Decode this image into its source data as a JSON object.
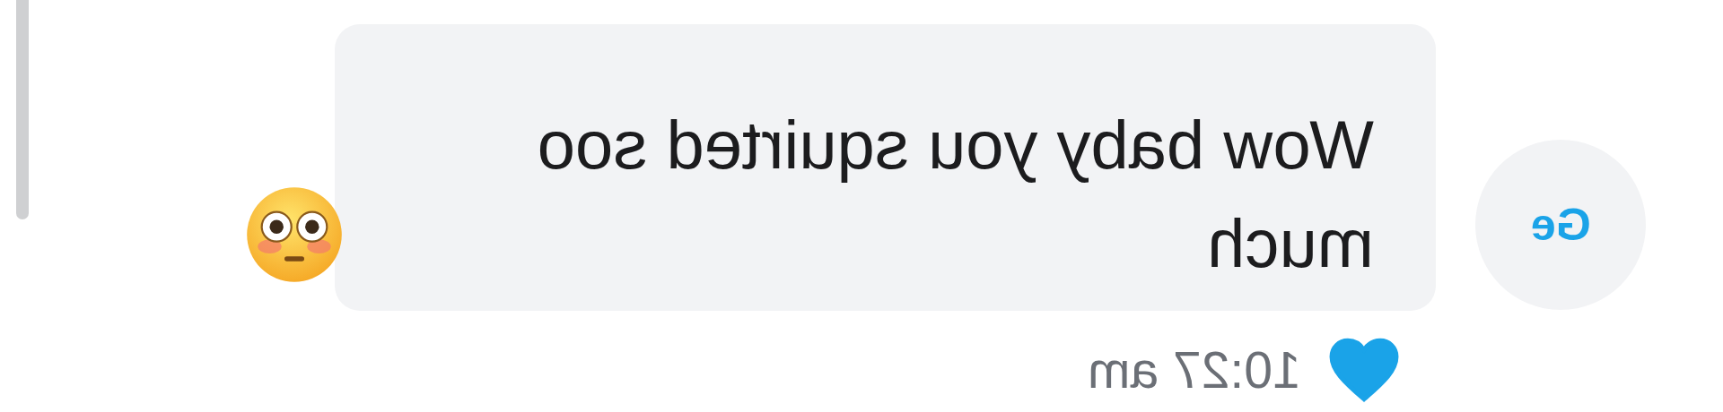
{
  "message": {
    "text": "Wow baby you squirted soo much",
    "time": "10:27 am",
    "liked": true,
    "reacted": true
  },
  "avatar": {
    "initials": "Ge"
  }
}
